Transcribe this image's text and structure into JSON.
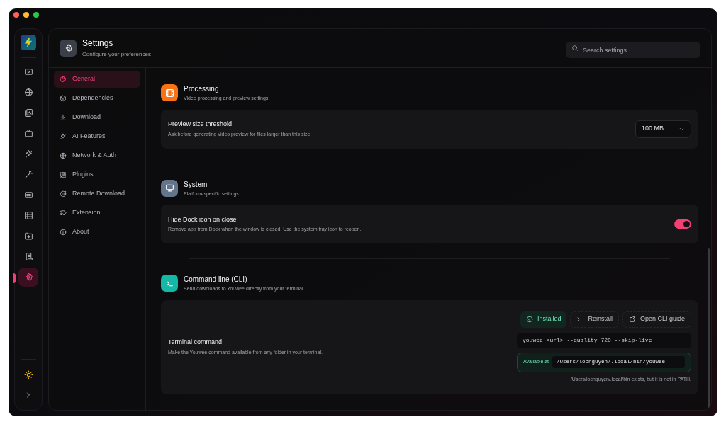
{
  "rail": {
    "items": [
      {
        "selected": false
      },
      {
        "selected": false
      },
      {
        "selected": false
      },
      {
        "selected": false
      },
      {
        "selected": false
      },
      {
        "selected": false
      },
      {
        "selected": false
      },
      {
        "selected": false
      },
      {
        "selected": false
      },
      {
        "selected": false
      },
      {
        "selected": true
      }
    ]
  },
  "header": {
    "title": "Settings",
    "subtitle": "Configure your preferences",
    "search": {
      "placeholder": "Search settings..."
    }
  },
  "nav": {
    "items": [
      {
        "label": "General",
        "selected": true
      },
      {
        "label": "Dependencies",
        "selected": false
      },
      {
        "label": "Download",
        "selected": false
      },
      {
        "label": "AI Features",
        "selected": false
      },
      {
        "label": "Network & Auth",
        "selected": false
      },
      {
        "label": "Plugins",
        "selected": false
      },
      {
        "label": "Remote Download",
        "selected": false
      },
      {
        "label": "Extension",
        "selected": false
      },
      {
        "label": "About",
        "selected": false
      }
    ]
  },
  "sections": [
    {
      "title": "Processing",
      "subtitle": "Video processing and preview settings",
      "color": "#f97316",
      "row": {
        "kind": "select",
        "label": "Preview size threshold",
        "description": "Ask before generating video preview for files larger than this size",
        "value": "100 MB"
      }
    },
    {
      "title": "System",
      "subtitle": "Platform-specific settings",
      "color": "#64748b",
      "row": {
        "kind": "toggle",
        "label": "Hide Dock icon on close",
        "description": "Remove app from Dock when the window is closed. Use the system tray icon to reopen.",
        "on": true
      }
    },
    {
      "title": "Command line (CLI)",
      "subtitle": "Send downloads to Youwee directly from your terminal.",
      "color": "#14b8a6",
      "row": {
        "kind": "cli",
        "label": "Terminal command",
        "description": "Make the Youwee command available from any folder in your terminal.",
        "buttons": [
          {
            "label": "Installed",
            "kind": "status"
          },
          {
            "label": "Reinstall",
            "kind": "action"
          },
          {
            "label": "Open CLI guide",
            "kind": "link"
          }
        ],
        "command": "youwee <url> --quality 720 --skip-live",
        "available_label": "Available at",
        "path": "/Users/locnguyen/.local/bin/youwee",
        "note": "/Users/locnguyen/.local/bin exists, but it is not in PATH."
      }
    }
  ]
}
